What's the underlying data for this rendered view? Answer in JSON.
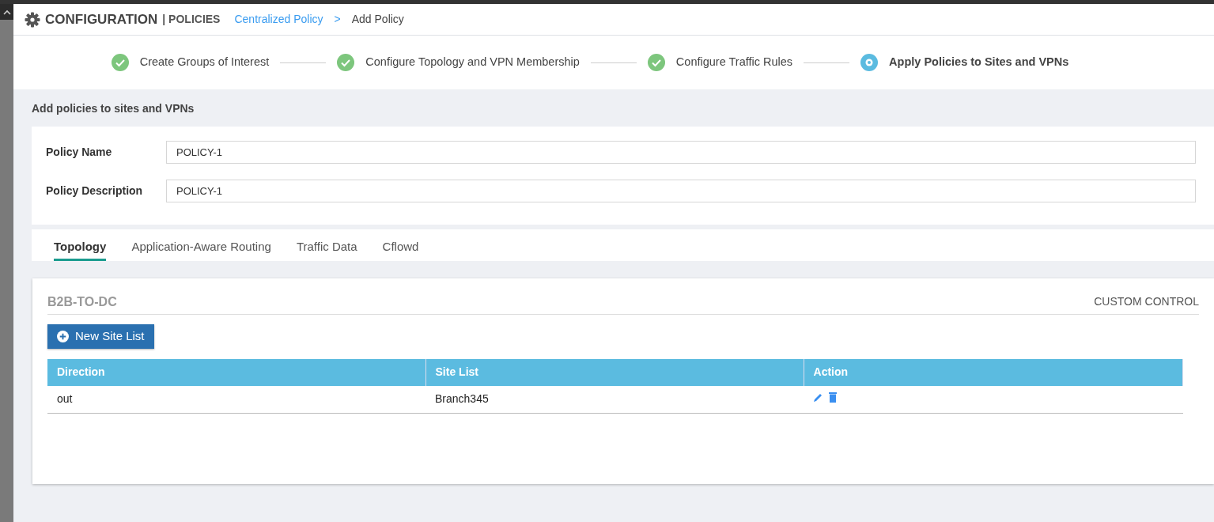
{
  "header": {
    "title": "CONFIGURATION",
    "subtitle": "| POLICIES",
    "breadcrumb": [
      {
        "label": "Centralized Policy",
        "kind": "link"
      },
      {
        "label": ">",
        "kind": "separator"
      },
      {
        "label": "Add Policy",
        "kind": "current"
      }
    ]
  },
  "steps": [
    {
      "label": "Create Groups of Interest",
      "completed": true,
      "current": false
    },
    {
      "label": "Configure Topology and VPN Membership",
      "completed": true,
      "current": false
    },
    {
      "label": "Configure Traffic Rules",
      "completed": true,
      "current": false
    },
    {
      "label": "Apply Policies to Sites and VPNs",
      "completed": false,
      "current": true
    }
  ],
  "section_title": "Add policies to sites and VPNs",
  "form": [
    {
      "label": "Policy Name",
      "value": "POLICY-1"
    },
    {
      "label": "Policy Description",
      "value": "POLICY-1"
    }
  ],
  "tabs": [
    {
      "label": "Topology",
      "selected": true
    },
    {
      "label": "Application-Aware Routing",
      "selected": false
    },
    {
      "label": "Traffic Data",
      "selected": false
    },
    {
      "label": "Cflowd",
      "selected": false
    }
  ],
  "panel": {
    "title": "B2B-TO-DC",
    "type_label": "CUSTOM CONTROL",
    "button": "New Site List",
    "table": {
      "columns": [
        "Direction",
        "Site List",
        "Action"
      ],
      "rows": [
        [
          "out",
          "Branch345"
        ]
      ]
    }
  }
}
